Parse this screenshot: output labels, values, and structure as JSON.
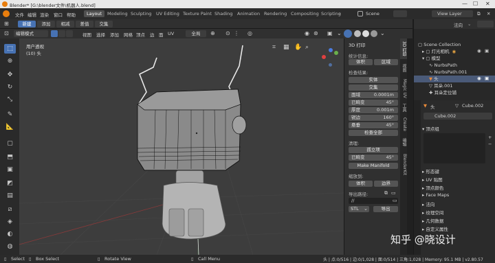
{
  "window": {
    "title": "Blender* [G:\\blender文件\\机器人.blend]"
  },
  "menu": [
    "文件",
    "编辑",
    "渲染",
    "窗口",
    "帮助"
  ],
  "workspaces": [
    "Layout",
    "Modeling",
    "Sculpting",
    "UV Editing",
    "Texture Paint",
    "Shading",
    "Animation",
    "Rendering",
    "Compositing",
    "Scripting"
  ],
  "scene": {
    "label": "Scene",
    "view_layer": "View Layer"
  },
  "header2": {
    "buttons": [
      "新建",
      "添加",
      "相减",
      "差值",
      "交集"
    ],
    "right_label": "法向"
  },
  "viewport_header": {
    "mode": "编辑模式",
    "menus": [
      "视图",
      "选择",
      "添加",
      "网格",
      "顶点",
      "边",
      "面",
      "UV"
    ],
    "transform": "全局"
  },
  "viewport": {
    "view_name": "用户透视",
    "object_name": "(10) 头"
  },
  "print_panel": {
    "tab_title": "3D 打印",
    "stats_label": "统计信息:",
    "volume_btn": "体积",
    "area_btn": "区域",
    "check_label": "检查结果:",
    "solid_btn": "实体",
    "intersect_btn": "交集",
    "fields": [
      {
        "k": "面域",
        "v": "0.0001m"
      },
      {
        "k": "已畸变",
        "v": "45°"
      },
      {
        "k": "厚度",
        "v": "0.001m"
      },
      {
        "k": "锐边",
        "v": "160°"
      },
      {
        "k": "悬垂",
        "v": "45°"
      }
    ],
    "check_all_btn": "检查全部",
    "cleanup_label": "清理:",
    "isolated_btn": "孤立项",
    "distort_field": {
      "k": "已畸变",
      "v": "45°"
    },
    "manifold_btn": "Make Manifold",
    "scale_label": "缩放到:",
    "scale_volume_btn": "体积",
    "scale_bounds_btn": "边界",
    "export_label": "导出路径:",
    "export_path": "//",
    "format": "STL",
    "export_btn": "导出"
  },
  "vertical_tabs": [
    "3D 打印",
    "视图",
    "Magic UV",
    "工具",
    "Create",
    "编辑",
    "BlenderKit"
  ],
  "outliner": {
    "rows": [
      {
        "name": "Scene Collection",
        "selected": false
      },
      {
        "name": "灯光相机",
        "selected": false
      },
      {
        "name": "模型",
        "selected": false
      },
      {
        "name": "NurbsPath",
        "selected": false
      },
      {
        "name": "NurbsPath.001",
        "selected": false
      },
      {
        "name": "头",
        "selected": true
      },
      {
        "name": "耳朵.001",
        "selected": false
      },
      {
        "name": "耳朵定位铺",
        "selected": false
      }
    ]
  },
  "properties": {
    "object": "头",
    "mesh": "Cube.002",
    "mesh_field": "Cube.002",
    "sections": [
      "顶点组",
      "形态键",
      "UV 贴图",
      "顶点颜色",
      "Face Maps",
      "法向",
      "纹理空间",
      "几何数据",
      "自定义属性"
    ]
  },
  "status": {
    "select": "Select",
    "box_select": "Box Select",
    "rotate": "Rotate View",
    "call_menu": "Call Menu",
    "stats": "头 | 点:0/516 | 边:0/1,028 | 面:0/514 | 三角:1,028 | Memory: 95.1 MB | v2.80.57"
  },
  "watermark": "知乎 @晓设计",
  "colors": {
    "accent": "#4772b3",
    "selected_row": "#4a5a78",
    "viewport_bg": "#3d3d3d"
  }
}
